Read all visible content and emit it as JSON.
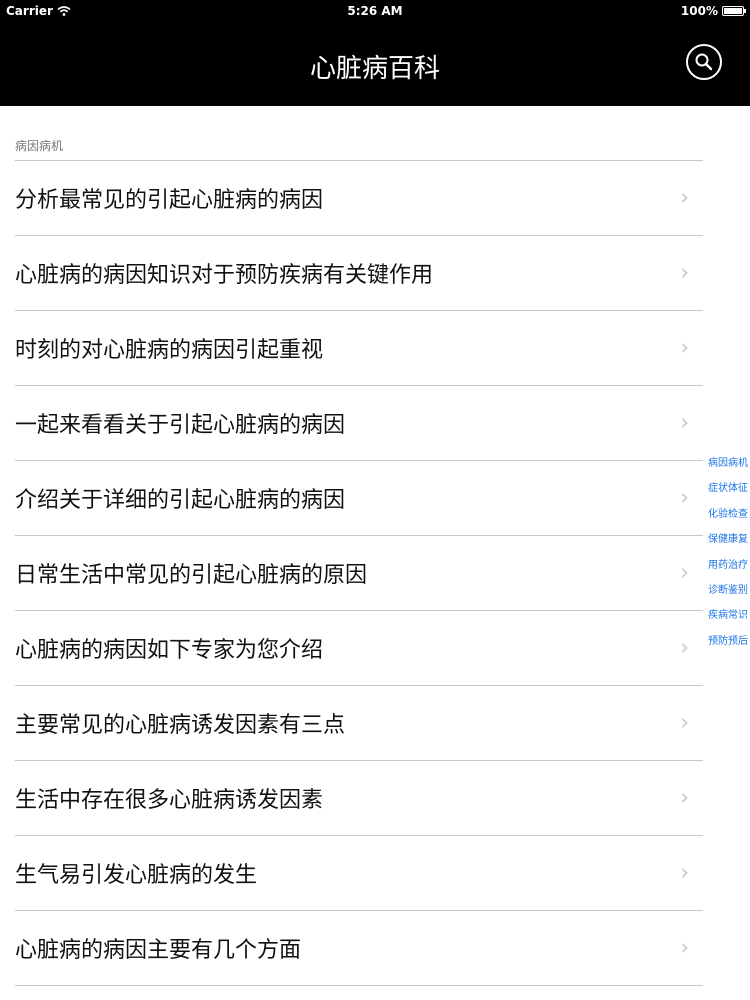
{
  "status_bar": {
    "carrier": "Carrier",
    "time": "5:26 AM",
    "battery": "100%"
  },
  "nav": {
    "title": "心脏病百科",
    "search_icon": "search-icon"
  },
  "section": {
    "header": "病因病机"
  },
  "list": {
    "items": [
      "分析最常见的引起心脏病的病因",
      "心脏病的病因知识对于预防疾病有关键作用",
      "时刻的对心脏病的病因引起重视",
      "一起来看看关于引起心脏病的病因",
      "介绍关于详细的引起心脏病的病因",
      "日常生活中常见的引起心脏病的原因",
      "心脏病的病因如下专家为您介绍",
      "主要常见的心脏病诱发因素有三点",
      "生活中存在很多心脏病诱发因素",
      "生气易引发心脏病的发生",
      "心脏病的病因主要有几个方面"
    ]
  },
  "index_bar": {
    "items": [
      "病因病机",
      "症状体征",
      "化验检查",
      "保健康复",
      "用药治疗",
      "诊断鉴别",
      "疾病常识",
      "预防预后"
    ]
  },
  "colors": {
    "nav_background": "#000000",
    "index_text": "#1a73e8",
    "separator": "#c8c7cc"
  }
}
